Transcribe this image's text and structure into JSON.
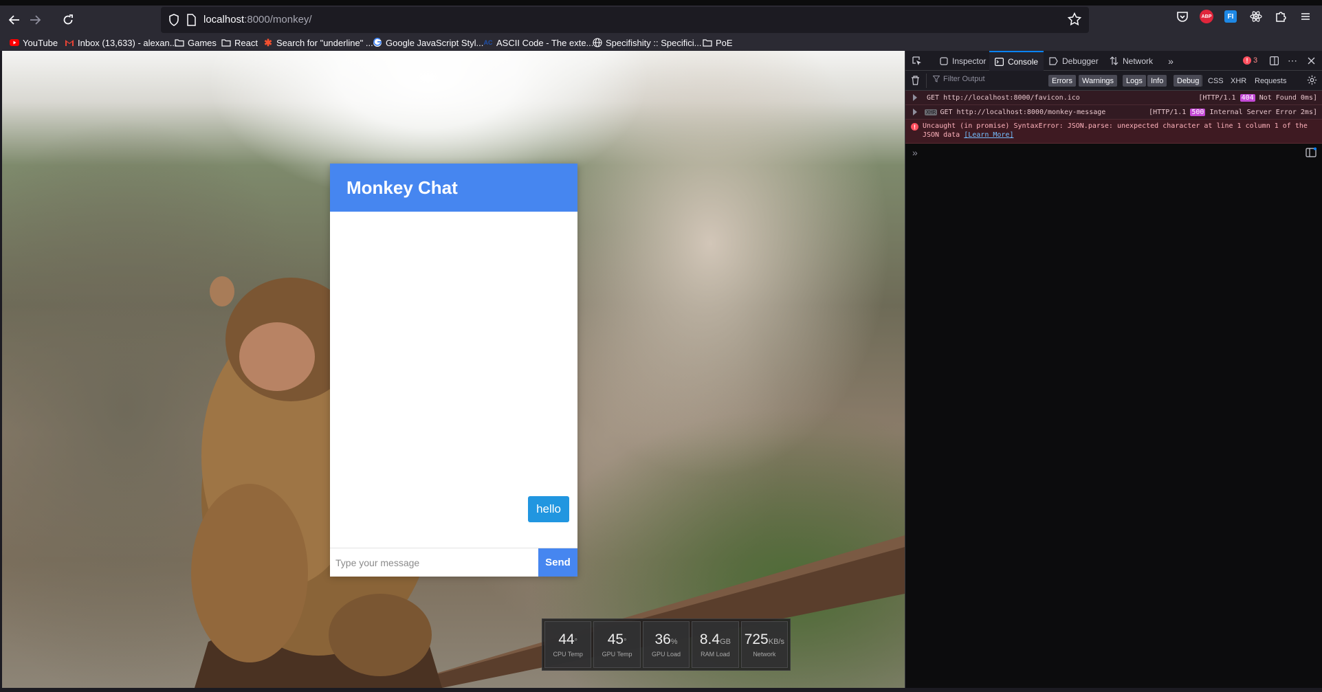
{
  "browser": {
    "url_host": "localhost",
    "url_rest": ":8000/monkey/",
    "bookmarks": [
      {
        "label": "YouTube",
        "icon": "youtube-icon"
      },
      {
        "label": "Inbox (13,633) - alexan...",
        "icon": "gmail-icon"
      },
      {
        "label": "Games",
        "icon": "folder-icon"
      },
      {
        "label": "React",
        "icon": "folder-icon"
      },
      {
        "label": "Search for \"underline\" ...",
        "icon": "asterisk-icon"
      },
      {
        "label": "Google JavaScript Styl...",
        "icon": "google-icon"
      },
      {
        "label": "ASCII Code - The exte...",
        "icon": "ascii-icon"
      },
      {
        "label": "Specifishity :: Specifici...",
        "icon": "globe-icon"
      },
      {
        "label": "PoE",
        "icon": "folder-icon"
      }
    ],
    "extensions": {
      "abp": "ABP",
      "ext": "FI"
    }
  },
  "chat": {
    "title": "Monkey Chat",
    "messages": [
      {
        "text": "hello"
      }
    ],
    "input_placeholder": "Type your message",
    "send_label": "Send",
    "header_color": "#4686f0",
    "bubble_color": "#2196e0"
  },
  "sysmon": [
    {
      "value": "44",
      "unit": "°",
      "label": "CPU Temp"
    },
    {
      "value": "45",
      "unit": "°",
      "label": "GPU Temp"
    },
    {
      "value": "36",
      "unit": "%",
      "label": "GPU Load"
    },
    {
      "value": "8.4",
      "unit": "GB",
      "label": "RAM Load"
    },
    {
      "value": "725",
      "unit": "KB/s",
      "label": "Network"
    }
  ],
  "devtools": {
    "tabs": [
      "Inspector",
      "Console",
      "Debugger",
      "Network"
    ],
    "active_tab": "Console",
    "error_count": "3",
    "filter_placeholder": "Filter Output",
    "filter_buttons": [
      "Errors",
      "Warnings",
      "Logs",
      "Info",
      "Debug"
    ],
    "filter_plain": [
      "CSS",
      "XHR",
      "Requests"
    ],
    "logs": [
      {
        "method": "GET",
        "url": "http://localhost:8000/favicon.ico",
        "proto": "[HTTP/1.1",
        "status": "404",
        "status_text": "Not Found 0ms]"
      },
      {
        "tag": "XHR",
        "method": "GET",
        "url": "http://localhost:8000/monkey-message",
        "proto": "[HTTP/1.1",
        "status": "500",
        "status_text": "Internal Server Error 2ms]"
      }
    ],
    "error_message": "Uncaught (in promise) SyntaxError: JSON.parse: unexpected character at line 1 column 1 of the JSON data",
    "error_link": "[Learn More]",
    "prompt": "»"
  }
}
